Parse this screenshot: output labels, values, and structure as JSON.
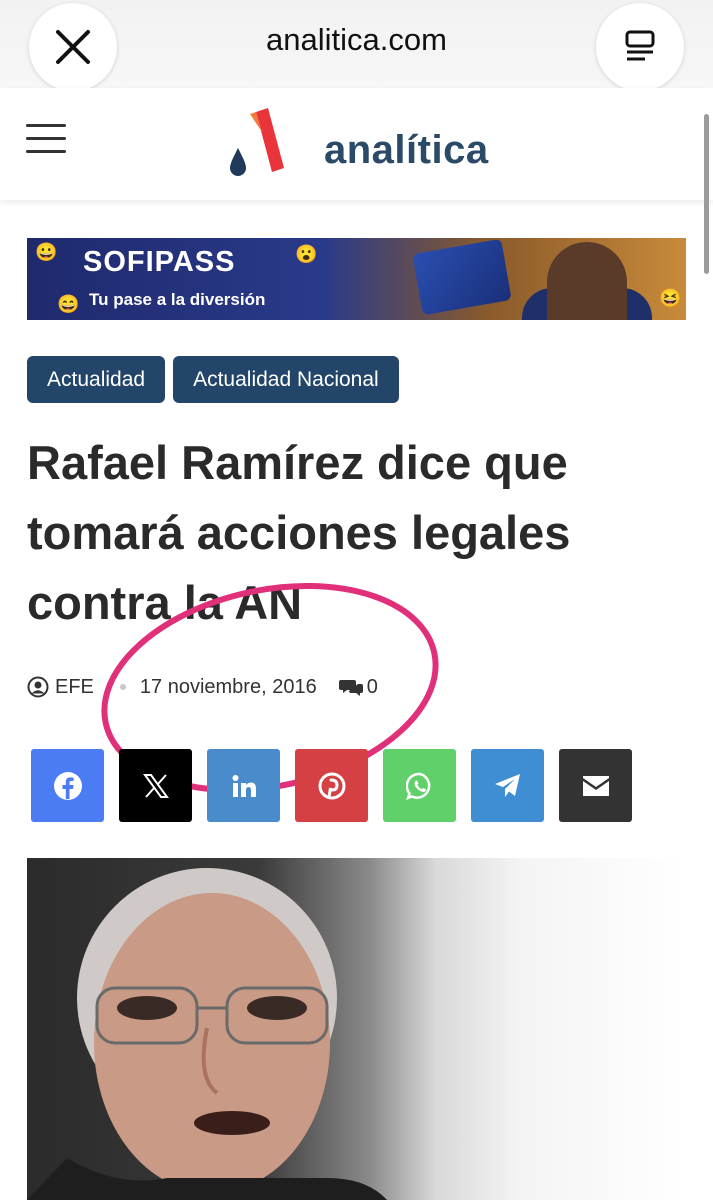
{
  "browser": {
    "url": "analitica.com",
    "close_icon": "close-icon",
    "reader_icon": "reader-mode-icon"
  },
  "site": {
    "logo_text": "analítica",
    "menu_icon": "hamburger-menu-icon"
  },
  "banner": {
    "brand_part1": "SOFI",
    "brand_part2": "PASS",
    "tagline": "Tu pase a la diversión"
  },
  "categories": [
    "Actualidad",
    "Actualidad Nacional"
  ],
  "article": {
    "title": "Rafael Ramírez dice que tomará acciones legales contra la AN",
    "author": "EFE",
    "date": "17 noviembre, 2016",
    "comments": "0"
  },
  "share_buttons": [
    {
      "name": "facebook",
      "icon": "facebook-icon",
      "color": "#4b7cf3"
    },
    {
      "name": "x",
      "icon": "x-icon",
      "color": "#000000"
    },
    {
      "name": "linkedin",
      "icon": "linkedin-icon",
      "color": "#4a8ccb"
    },
    {
      "name": "pinterest",
      "icon": "pinterest-icon",
      "color": "#d54044"
    },
    {
      "name": "whatsapp",
      "icon": "whatsapp-icon",
      "color": "#5fd06a"
    },
    {
      "name": "telegram",
      "icon": "telegram-icon",
      "color": "#3f8ed3"
    },
    {
      "name": "email",
      "icon": "email-icon",
      "color": "#333333"
    }
  ],
  "colors": {
    "accent_dark_blue": "#23456a",
    "logo_blue": "#2b4a67",
    "annotation_pink": "#e0307a"
  }
}
